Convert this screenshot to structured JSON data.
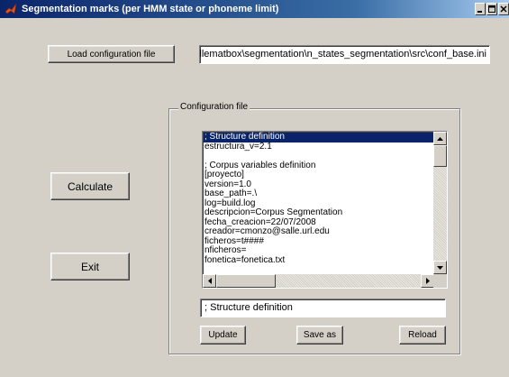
{
  "window": {
    "title": "Segmentation marks (per HMM state or phoneme limit)"
  },
  "buttons": {
    "load_config": "Load configuration file",
    "calculate": "Calculate",
    "exit": "Exit",
    "update": "Update",
    "save_as": "Save as",
    "reload": "Reload"
  },
  "config_path": "prio\\sallematbox\\segmentation\\n_states_segmentation\\src\\conf_base.ini",
  "config_group": {
    "label": "Configuration file",
    "lines": [
      "; Structure definition",
      "estructura_v=2.1",
      "",
      "; Corpus variables definition",
      "[proyecto]",
      "version=1.0",
      "base_path=.\\",
      "log=build.log",
      "descripcion=Corpus Segmentation",
      "fecha_creacion=22/07/2008",
      "creador=cmonzo@salle.url.edu",
      "ficheros=t####",
      "nficheros=",
      "fonetica=fonetica.txt"
    ],
    "selected_index": 0,
    "edit_value": "; Structure definition"
  },
  "colors": {
    "titlebar_start": "#0a246a",
    "titlebar_end": "#a6caf0",
    "face": "#d4d0c8",
    "selection": "#0a246a"
  },
  "icons": {
    "app": "matlab-icon",
    "minimize": "minimize-icon",
    "maximize": "maximize-icon",
    "close": "close-icon"
  }
}
